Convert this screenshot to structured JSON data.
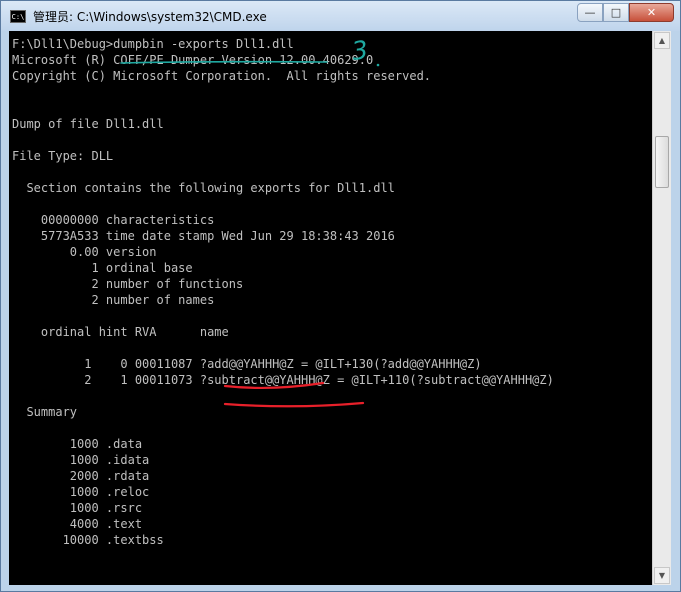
{
  "window": {
    "title": "管理员: C:\\Windows\\system32\\CMD.exe",
    "icon_text": "C:\\",
    "minimize_glyph": "—",
    "maximize_glyph": "□",
    "close_glyph": "✕"
  },
  "console": {
    "lines": [
      "F:\\Dll1\\Debug>dumpbin -exports Dll1.dll",
      "Microsoft (R) COFF/PE Dumper Version 12.00.40629.0",
      "Copyright (C) Microsoft Corporation.  All rights reserved.",
      "",
      "",
      "Dump of file Dll1.dll",
      "",
      "File Type: DLL",
      "",
      "  Section contains the following exports for Dll1.dll",
      "",
      "    00000000 characteristics",
      "    5773A533 time date stamp Wed Jun 29 18:38:43 2016",
      "        0.00 version",
      "           1 ordinal base",
      "           2 number of functions",
      "           2 number of names",
      "",
      "    ordinal hint RVA      name",
      "",
      "          1    0 00011087 ?add@@YAHHH@Z = @ILT+130(?add@@YAHHH@Z)",
      "          2    1 00011073 ?subtract@@YAHHH@Z = @ILT+110(?subtract@@YAHHH@Z)",
      "",
      "  Summary",
      "",
      "        1000 .data",
      "        1000 .idata",
      "        2000 .rdata",
      "        1000 .reloc",
      "        1000 .rsrc",
      "        4000 .text",
      "       10000 .textbss"
    ]
  },
  "annotations": {
    "handwritten_number": "3"
  },
  "colors": {
    "console_bg": "#000000",
    "console_text": "#c0c0c0",
    "annotation_teal": "#1fa8a0",
    "annotation_red": "#e8202a"
  }
}
